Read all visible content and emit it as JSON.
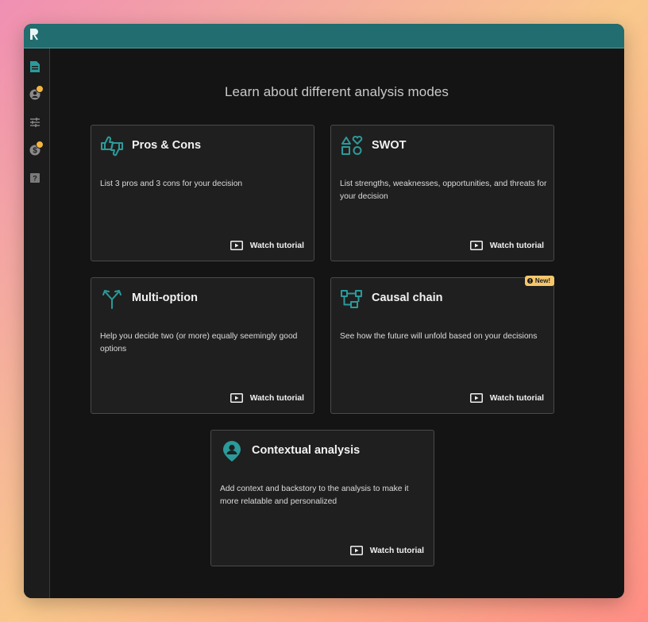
{
  "app": {
    "heading": "Learn about different analysis modes"
  },
  "sidebar": {
    "items": [
      {
        "name": "document-icon",
        "active": true
      },
      {
        "name": "user-alert-icon",
        "badge": true
      },
      {
        "name": "sliders-icon"
      },
      {
        "name": "dollar-alert-icon",
        "badge": true
      },
      {
        "name": "help-icon"
      }
    ]
  },
  "cards": [
    {
      "id": "pros-cons",
      "title": "Pros & Cons",
      "description": "List 3 pros and 3 cons for your decision",
      "tutorial_label": "Watch tutorial",
      "icon": "thumbs-up-down-icon"
    },
    {
      "id": "swot",
      "title": "SWOT",
      "description": "List strengths, weaknesses, opportunities, and threats for your decision",
      "tutorial_label": "Watch tutorial",
      "icon": "shapes-icon"
    },
    {
      "id": "multi-option",
      "title": "Multi-option",
      "description": "Help you decide two (or more) equally seemingly good options",
      "tutorial_label": "Watch tutorial",
      "icon": "branch-arrows-icon"
    },
    {
      "id": "causal-chain",
      "title": "Causal chain",
      "description": "See how the future will unfold based on your decisions",
      "tutorial_label": "Watch tutorial",
      "icon": "flowchart-icon",
      "badge": "New!"
    },
    {
      "id": "contextual-analysis",
      "title": "Contextual analysis",
      "description": "Add context and backstory to the analysis to make it more relatable and personalized",
      "tutorial_label": "Watch tutorial",
      "icon": "person-pin-icon"
    }
  ],
  "colors": {
    "accent": "#2c8f8f",
    "topbar": "#216d6f",
    "badge": "#f6c66a",
    "alert": "#f4b53f"
  }
}
